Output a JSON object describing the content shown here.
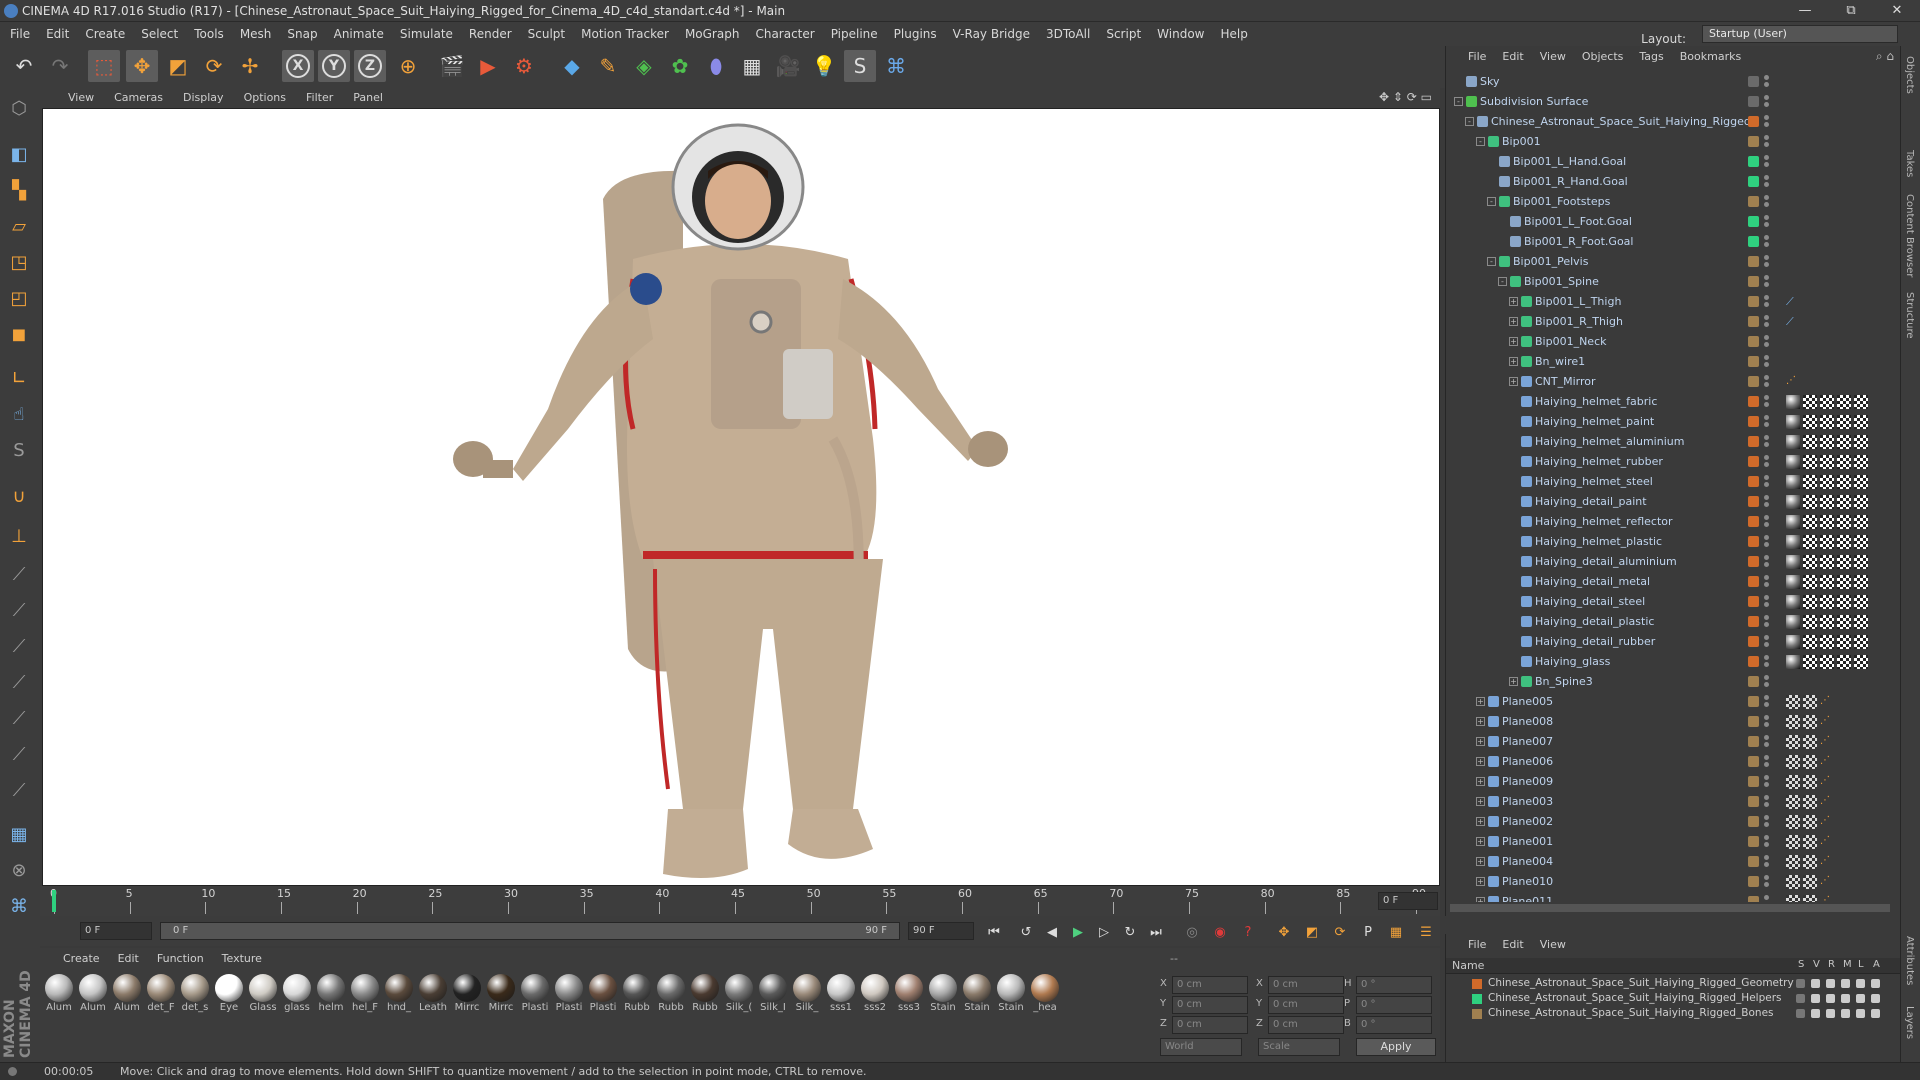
{
  "window": {
    "title": "CINEMA 4D R17.016 Studio (R17) - [Chinese_Astronaut_Space_Suit_Haiying_Rigged_for_Cinema_4D_c4d_standart.c4d *] - Main",
    "minimize": "—",
    "restore": "⧉",
    "close": "✕"
  },
  "menu": [
    "File",
    "Edit",
    "Create",
    "Select",
    "Tools",
    "Mesh",
    "Snap",
    "Animate",
    "Simulate",
    "Render",
    "Sculpt",
    "Motion Tracker",
    "MoGraph",
    "Character",
    "Pipeline",
    "Plugins",
    "V-Ray Bridge",
    "3DToAll",
    "Script",
    "Window",
    "Help"
  ],
  "layout": {
    "label": "Layout:",
    "value": "Startup (User)"
  },
  "viewport": {
    "menu": [
      "View",
      "Cameras",
      "Display",
      "Options",
      "Filter",
      "Panel"
    ]
  },
  "timeline": {
    "ticks": [
      "0",
      "5",
      "10",
      "15",
      "20",
      "25",
      "30",
      "35",
      "40",
      "45",
      "50",
      "55",
      "60",
      "65",
      "70",
      "75",
      "80",
      "85",
      "90"
    ],
    "current_frame_right": "0 F",
    "start_field": "0 F",
    "min_field": "0 F",
    "max_field": "90 F",
    "end_field": "90 F"
  },
  "materials": {
    "menu": [
      "Create",
      "Edit",
      "Function",
      "Texture"
    ],
    "items": [
      "Alum",
      "Alum",
      "Alum",
      "det_F",
      "det_s",
      "Eye",
      "Glass",
      "glass",
      "helm",
      "hel_F",
      "hnd_",
      "Leath",
      "Mirrc",
      "Mirrc",
      "Plasti",
      "Plasti",
      "Plasti",
      "Rubb",
      "Rubb",
      "Rubb",
      "Silk_(",
      "Silk_I",
      "Silk_",
      "sss1",
      "sss2",
      "sss3",
      "Stain",
      "Stain",
      "Stain",
      "_hea"
    ],
    "colors": [
      "#b9b9b9",
      "#c4c4c4",
      "#8c7b6a",
      "#9b8a78",
      "#a69a8a",
      "#ffffff",
      "#cfcbc4",
      "#d8d8d8",
      "#777777",
      "#8a8a8a",
      "#5a4a3c",
      "#4a3e34",
      "#222222",
      "#3a2a1a",
      "#6a6a6a",
      "#8a8a8a",
      "#6a5040",
      "#555555",
      "#6a6a6a",
      "#4a3a30",
      "#7a7a7a",
      "#5a5a5a",
      "#9a8a7a",
      "#c8c8c8",
      "#cfc8c0",
      "#a08070",
      "#a8a8a8",
      "#8a7a6a",
      "#b8b8b8",
      "#b07a50"
    ]
  },
  "coords": {
    "rows": [
      {
        "a": "X",
        "av": "0 cm",
        "b": "X",
        "bv": "0 cm",
        "c": "H",
        "cv": "0 °"
      },
      {
        "a": "Y",
        "av": "0 cm",
        "b": "Y",
        "bv": "0 cm",
        "c": "P",
        "cv": "0 °"
      },
      {
        "a": "Z",
        "av": "0 cm",
        "b": "Z",
        "bv": "0 cm",
        "c": "B",
        "cv": "0 °"
      }
    ],
    "world": "World",
    "scale": "Scale",
    "apply": "Apply",
    "header": "--"
  },
  "objects": {
    "menu": [
      "File",
      "Edit",
      "View",
      "Objects",
      "Tags",
      "Bookmarks"
    ],
    "rows": [
      {
        "name": "Sky",
        "indent": 0,
        "icon": "#8aa6c8",
        "tag": "#6a6a6a",
        "expand": ""
      },
      {
        "name": "Subdivision Surface",
        "indent": 0,
        "icon": "#4fc04f",
        "tag": "#6a6a6a",
        "expand": "-"
      },
      {
        "name": "Chinese_Astronaut_Space_Suit_Haiying_Rigged",
        "indent": 1,
        "icon": "#8aa6c8",
        "tag": "#d06a2a",
        "expand": "-"
      },
      {
        "name": "Bip001",
        "indent": 2,
        "icon": "#3fc07f",
        "tag": "#a08050",
        "expand": "-"
      },
      {
        "name": "Bip001_L_Hand.Goal",
        "indent": 3,
        "icon": "#8aa6c8",
        "tag": "#2fd07f",
        "expand": ""
      },
      {
        "name": "Bip001_R_Hand.Goal",
        "indent": 3,
        "icon": "#8aa6c8",
        "tag": "#2fd07f",
        "expand": ""
      },
      {
        "name": "Bip001_Footsteps",
        "indent": 3,
        "icon": "#3fc07f",
        "tag": "#a08050",
        "expand": "-"
      },
      {
        "name": "Bip001_L_Foot.Goal",
        "indent": 4,
        "icon": "#8aa6c8",
        "tag": "#2fd07f",
        "expand": ""
      },
      {
        "name": "Bip001_R_Foot.Goal",
        "indent": 4,
        "icon": "#8aa6c8",
        "tag": "#2fd07f",
        "expand": ""
      },
      {
        "name": "Bip001_Pelvis",
        "indent": 3,
        "icon": "#3fc07f",
        "tag": "#a08050",
        "expand": "-"
      },
      {
        "name": "Bip001_Spine",
        "indent": 4,
        "icon": "#3fc07f",
        "tag": "#a08050",
        "expand": "-"
      },
      {
        "name": "Bip001_L_Thigh",
        "indent": 5,
        "icon": "#3fc07f",
        "tag": "#a08050",
        "expand": "+"
      },
      {
        "name": "Bip001_R_Thigh",
        "indent": 5,
        "icon": "#3fc07f",
        "tag": "#a08050",
        "expand": "+"
      },
      {
        "name": "Bip001_Neck",
        "indent": 5,
        "icon": "#3fc07f",
        "tag": "#a08050",
        "expand": "+"
      },
      {
        "name": "Bn_wire1",
        "indent": 5,
        "icon": "#3fc07f",
        "tag": "#a08050",
        "expand": "+"
      },
      {
        "name": "CNT_Mirror",
        "indent": 5,
        "icon": "#7aa4d8",
        "tag": "#a08050",
        "expand": "+"
      },
      {
        "name": "Haiying_helmet_fabric",
        "indent": 5,
        "icon": "#7aa4d8",
        "tag": "#d06a2a",
        "expand": ""
      },
      {
        "name": "Haiying_helmet_paint",
        "indent": 5,
        "icon": "#7aa4d8",
        "tag": "#d06a2a",
        "expand": ""
      },
      {
        "name": "Haiying_helmet_aluminium",
        "indent": 5,
        "icon": "#7aa4d8",
        "tag": "#d06a2a",
        "expand": ""
      },
      {
        "name": "Haiying_helmet_rubber",
        "indent": 5,
        "icon": "#7aa4d8",
        "tag": "#d06a2a",
        "expand": ""
      },
      {
        "name": "Haiying_helmet_steel",
        "indent": 5,
        "icon": "#7aa4d8",
        "tag": "#d06a2a",
        "expand": ""
      },
      {
        "name": "Haiying_detail_paint",
        "indent": 5,
        "icon": "#7aa4d8",
        "tag": "#d06a2a",
        "expand": ""
      },
      {
        "name": "Haiying_helmet_reflector",
        "indent": 5,
        "icon": "#7aa4d8",
        "tag": "#d06a2a",
        "expand": ""
      },
      {
        "name": "Haiying_helmet_plastic",
        "indent": 5,
        "icon": "#7aa4d8",
        "tag": "#d06a2a",
        "expand": ""
      },
      {
        "name": "Haiying_detail_aluminium",
        "indent": 5,
        "icon": "#7aa4d8",
        "tag": "#d06a2a",
        "expand": ""
      },
      {
        "name": "Haiying_detail_metal",
        "indent": 5,
        "icon": "#7aa4d8",
        "tag": "#d06a2a",
        "expand": ""
      },
      {
        "name": "Haiying_detail_steel",
        "indent": 5,
        "icon": "#7aa4d8",
        "tag": "#d06a2a",
        "expand": ""
      },
      {
        "name": "Haiying_detail_plastic",
        "indent": 5,
        "icon": "#7aa4d8",
        "tag": "#d06a2a",
        "expand": ""
      },
      {
        "name": "Haiying_detail_rubber",
        "indent": 5,
        "icon": "#7aa4d8",
        "tag": "#d06a2a",
        "expand": ""
      },
      {
        "name": "Haiying_glass",
        "indent": 5,
        "icon": "#7aa4d8",
        "tag": "#d06a2a",
        "expand": ""
      },
      {
        "name": "Bn_Spine3",
        "indent": 5,
        "icon": "#3fc07f",
        "tag": "#a08050",
        "expand": "+"
      },
      {
        "name": "Plane005",
        "indent": 2,
        "icon": "#7aa4d8",
        "tag": "#a08050",
        "expand": "+"
      },
      {
        "name": "Plane008",
        "indent": 2,
        "icon": "#7aa4d8",
        "tag": "#a08050",
        "expand": "+"
      },
      {
        "name": "Plane007",
        "indent": 2,
        "icon": "#7aa4d8",
        "tag": "#a08050",
        "expand": "+"
      },
      {
        "name": "Plane006",
        "indent": 2,
        "icon": "#7aa4d8",
        "tag": "#a08050",
        "expand": "+"
      },
      {
        "name": "Plane009",
        "indent": 2,
        "icon": "#7aa4d8",
        "tag": "#a08050",
        "expand": "+"
      },
      {
        "name": "Plane003",
        "indent": 2,
        "icon": "#7aa4d8",
        "tag": "#a08050",
        "expand": "+"
      },
      {
        "name": "Plane002",
        "indent": 2,
        "icon": "#7aa4d8",
        "tag": "#a08050",
        "expand": "+"
      },
      {
        "name": "Plane001",
        "indent": 2,
        "icon": "#7aa4d8",
        "tag": "#a08050",
        "expand": "+"
      },
      {
        "name": "Plane004",
        "indent": 2,
        "icon": "#7aa4d8",
        "tag": "#a08050",
        "expand": "+"
      },
      {
        "name": "Plane010",
        "indent": 2,
        "icon": "#7aa4d8",
        "tag": "#a08050",
        "expand": "+"
      },
      {
        "name": "Plane011",
        "indent": 2,
        "icon": "#7aa4d8",
        "tag": "#a08050",
        "expand": "+"
      }
    ]
  },
  "layers": {
    "menu": [
      "File",
      "Edit",
      "View"
    ],
    "col_name": "Name",
    "cols": [
      "S",
      "V",
      "R",
      "M",
      "L",
      "A"
    ],
    "items": [
      {
        "name": "Chinese_Astronaut_Space_Suit_Haiying_Rigged_Geometry",
        "color": "#d06a2a"
      },
      {
        "name": "Chinese_Astronaut_Space_Suit_Haiying_Rigged_Helpers",
        "color": "#2fd07f"
      },
      {
        "name": "Chinese_Astronaut_Space_Suit_Haiying_Rigged_Bones",
        "color": "#a08050"
      }
    ]
  },
  "right_tabs": [
    "Objects",
    "Takes",
    "Content Browser",
    "Structure",
    "Attributes",
    "Layers"
  ],
  "status": {
    "time": "00:00:05",
    "message": "Move: Click and drag to move elements. Hold down SHIFT to quantize movement / add to the selection in point mode, CTRL to remove."
  }
}
